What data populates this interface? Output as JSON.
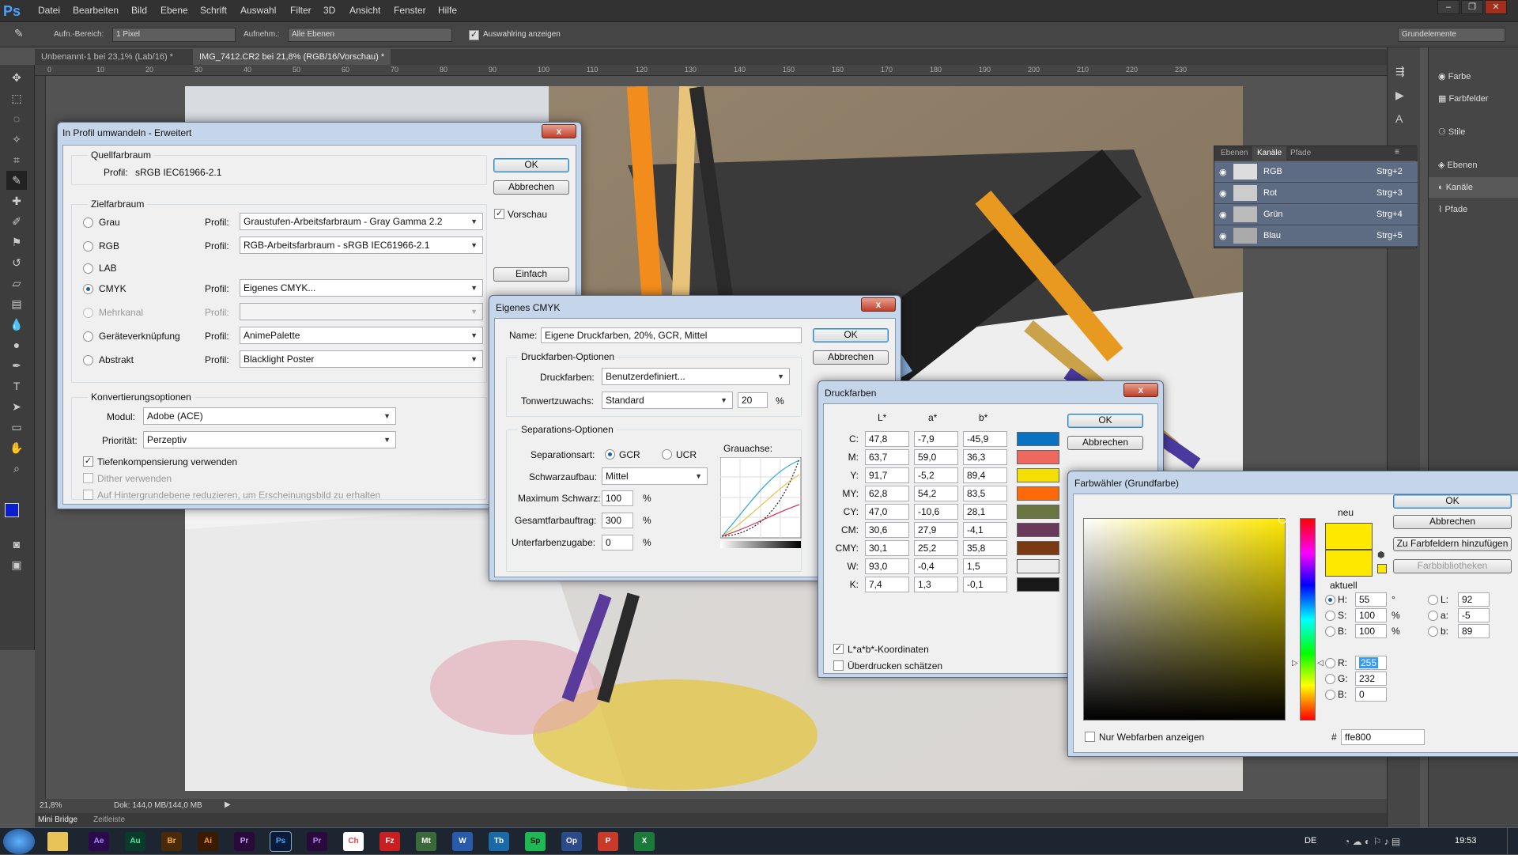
{
  "app": {
    "logo": "Ps",
    "menu": [
      "Datei",
      "Bearbeiten",
      "Bild",
      "Ebene",
      "Schrift",
      "Auswahl",
      "Filter",
      "3D",
      "Ansicht",
      "Fenster",
      "Hilfe"
    ],
    "window_controls": [
      "–",
      "❐",
      "✕"
    ]
  },
  "options": {
    "sample_size_label": "Aufn.-Bereich:",
    "sample_size_value": "1 Pixel",
    "sample_label": "Aufnehm.:",
    "sample_value": "Alle Ebenen",
    "show_ring_label": "Auswahlring anzeigen",
    "workspace": "Grundelemente"
  },
  "tabs": [
    {
      "label": "Unbenannt-1 bei 23,1% (Lab/16) *"
    },
    {
      "label": "IMG_7412.CR2 bei 21,8% (RGB/16/Vorschau) *"
    }
  ],
  "ruler_h_ticks": [
    "0",
    "10",
    "20",
    "30",
    "40",
    "50",
    "60",
    "70",
    "80",
    "90",
    "100",
    "110",
    "120",
    "130",
    "140",
    "150",
    "160",
    "170",
    "180",
    "190",
    "200",
    "210",
    "220",
    "230"
  ],
  "status": {
    "zoom": "21,8%",
    "doc": "Dok: 144,0 MB/144,0 MB"
  },
  "bottom_tabs": [
    "Mini Bridge",
    "Zeitleiste"
  ],
  "panel_col": [
    "Farbe",
    "Farbfelder",
    "Stile",
    "Ebenen",
    "Kanäle",
    "Pfade"
  ],
  "channels": {
    "tabs": [
      "Ebenen",
      "Kanäle",
      "Pfade"
    ],
    "rows": [
      {
        "name": "RGB",
        "shortcut": "Strg+2"
      },
      {
        "name": "Rot",
        "shortcut": "Strg+3"
      },
      {
        "name": "Grün",
        "shortcut": "Strg+4"
      },
      {
        "name": "Blau",
        "shortcut": "Strg+5"
      }
    ]
  },
  "profile_dialog": {
    "title": "In Profil umwandeln - Erweitert",
    "close": "x",
    "source_group": "Quellfarbraum",
    "source_label": "Profil:",
    "source_value": "sRGB IEC61966-2.1",
    "target_group": "Zielfarbraum",
    "ok": "OK",
    "cancel": "Abbrechen",
    "preview": "Vorschau",
    "simple": "Einfach",
    "rows": [
      {
        "label": "Grau",
        "profile_label": "Profil:",
        "value": "Graustufen-Arbeitsfarbraum - Gray Gamma 2.2"
      },
      {
        "label": "RGB",
        "profile_label": "Profil:",
        "value": "RGB-Arbeitsfarbraum - sRGB IEC61966-2.1"
      },
      {
        "label": "LAB",
        "profile_label": "",
        "value": ""
      },
      {
        "label": "CMYK",
        "profile_label": "Profil:",
        "value": "Eigenes CMYK..."
      },
      {
        "label": "Mehrkanal",
        "profile_label": "Profil:",
        "value": ""
      },
      {
        "label": "Geräteverknüpfung",
        "profile_label": "Profil:",
        "value": "AnimePalette"
      },
      {
        "label": "Abstrakt",
        "profile_label": "Profil:",
        "value": "Blacklight Poster"
      }
    ],
    "conv_group": "Konvertierungsoptionen",
    "module_label": "Modul:",
    "module_value": "Adobe (ACE)",
    "priority_label": "Priorität:",
    "priority_value": "Perzeptiv",
    "cb_depth": "Tiefenkompensierung verwenden",
    "cb_dither": "Dither verwenden",
    "cb_flatten": "Auf Hintergrundebene reduzieren, um Erscheinungsbild zu erhalten"
  },
  "cmyk_dialog": {
    "title": "Eigenes CMYK",
    "close": "x",
    "name_label": "Name:",
    "name_value": "Eigene Druckfarben, 20%, GCR, Mittel",
    "ok": "OK",
    "cancel": "Abbrechen",
    "inks_group": "Druckfarben-Optionen",
    "inks_label": "Druckfarben:",
    "inks_value": "Benutzerdefiniert...",
    "dot_gain_label": "Tonwertzuwachs:",
    "dot_gain_mode": "Standard",
    "dot_gain_value": "20",
    "percent": "%",
    "sep_group": "Separations-Optionen",
    "sep_type_label": "Separationsart:",
    "gcr": "GCR",
    "ucr": "UCR",
    "black_gen_label": "Schwarzaufbau:",
    "black_gen_value": "Mittel",
    "max_black_label": "Maximum Schwarz:",
    "max_black_value": "100",
    "total_ink_label": "Gesamtfarbauftrag:",
    "total_ink_value": "300",
    "uca_label": "Unterfarbenzugabe:",
    "uca_value": "0",
    "gray_ramp_label": "Grauachse:"
  },
  "inks_dialog": {
    "title": "Druckfarben",
    "close": "x",
    "headers": [
      "L*",
      "a*",
      "b*"
    ],
    "ok": "OK",
    "cancel": "Abbrechen",
    "rows": [
      {
        "label": "C:",
        "L": "47,8",
        "a": "-7,9",
        "b": "-45,9",
        "color": "#0a72c2"
      },
      {
        "label": "M:",
        "L": "63,7",
        "a": "59,0",
        "b": "36,3",
        "color": "#ef6860"
      },
      {
        "label": "Y:",
        "L": "91,7",
        "a": "-5,2",
        "b": "89,4",
        "color": "#f4e000"
      },
      {
        "label": "MY:",
        "L": "62,8",
        "a": "54,2",
        "b": "83,5",
        "color": "#ff6a08"
      },
      {
        "label": "CY:",
        "L": "47,0",
        "a": "-10,6",
        "b": "28,1",
        "color": "#6a7540"
      },
      {
        "label": "CM:",
        "L": "30,6",
        "a": "27,9",
        "b": "-4,1",
        "color": "#6a3a5a"
      },
      {
        "label": "CMY:",
        "L": "30,1",
        "a": "25,2",
        "b": "35,8",
        "color": "#7a3a12"
      },
      {
        "label": "W:",
        "L": "93,0",
        "a": "-0,4",
        "b": "1,5",
        "color": "#ececec"
      },
      {
        "label": "K:",
        "L": "7,4",
        "a": "1,3",
        "b": "-0,1",
        "color": "#181818"
      }
    ],
    "cb_lab": "L*a*b*-Koordinaten",
    "cb_overprint": "Überdrucken schätzen"
  },
  "picker_dialog": {
    "title": "Farbwähler (Grundfarbe)",
    "ok": "OK",
    "cancel": "Abbrechen",
    "add_swatch": "Zu Farbfeldern hinzufügen",
    "libraries": "Farbbibliotheken",
    "new_label": "neu",
    "current_label": "aktuell",
    "new_color": "#ffe800",
    "current_color": "#ffe800",
    "hsb": [
      {
        "label": "H:",
        "value": "55",
        "unit": "°"
      },
      {
        "label": "S:",
        "value": "100",
        "unit": "%"
      },
      {
        "label": "B:",
        "value": "100",
        "unit": "%"
      }
    ],
    "rgb": [
      {
        "label": "R:",
        "value": "255"
      },
      {
        "label": "G:",
        "value": "232"
      },
      {
        "label": "B:",
        "value": "0"
      }
    ],
    "lab": [
      {
        "label": "L:",
        "value": "92"
      },
      {
        "label": "a:",
        "value": "-5"
      },
      {
        "label": "b:",
        "value": "89"
      }
    ],
    "web_only": "Nur Webfarben anzeigen",
    "hash": "#",
    "hex": "ffe800"
  },
  "taskbar": {
    "lang": "DE",
    "time": "19:53",
    "icons": [
      "Ae",
      "Au",
      "Br",
      "Ai",
      "Pr",
      "Ps",
      "Pr",
      "Ch",
      "Fz",
      "Mt",
      "W",
      "Tb",
      "Sp",
      "Op",
      "P",
      "X"
    ]
  },
  "colors": {
    "accent": "#1f5ea8",
    "photo_orange": "#f28c1c",
    "foreground": "#0a1ed0"
  }
}
